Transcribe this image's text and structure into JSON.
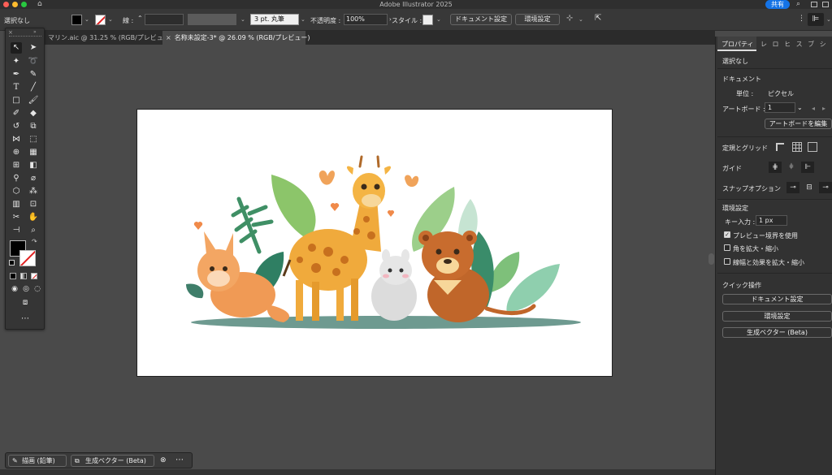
{
  "window": {
    "title": "Adobe Illustrator 2025",
    "share_label": "共有"
  },
  "controlbar": {
    "selection": "選択なし",
    "stroke_label": "線 :",
    "brush_label": "3 pt. 丸筆",
    "opacity_label": "不透明度 :",
    "opacity_value": "100%",
    "style_label": "スタイル :",
    "document_settings": "ドキュメント設定",
    "preferences": "環境設定"
  },
  "tabs": [
    {
      "label": "マリン.aic @ 31.25 % (RGB/プレビュー)"
    },
    {
      "label": "名称未設定-3* @ 26.09 % (RGB/プレビュー)"
    }
  ],
  "properties": {
    "tab_active": "プロパティ",
    "tab_others": "レ ロ ヒ ス ブ シ ア",
    "selection": "選択なし",
    "doc_section": "ドキュメント",
    "unit_label": "単位 :",
    "unit_value": "ピクセル",
    "artboard_label": "アートボード :",
    "artboard_value": "1",
    "edit_artboard": "アートボードを編集",
    "rulers_grids": "定規とグリッド",
    "guides": "ガイド",
    "snap_options": "スナップオプション",
    "prefs_section": "環境設定",
    "key_increment_label": "キー入力 :",
    "key_increment_value": "1 px",
    "preview_bounds": "プレビュー境界を使用",
    "scale_corners": "角を拡大・縮小",
    "scale_strokes": "線幅と効果を拡大・縮小",
    "quick_actions": "クイック操作",
    "qa_document_settings": "ドキュメント設定",
    "qa_preferences": "環境設定",
    "qa_generative_vector": "生成ベクター (Beta)"
  },
  "bottom": {
    "draw_mode": "描画 (鉛筆)",
    "generative_vector": "生成ベクター (Beta)"
  },
  "colors": {
    "accent": "#1473e6",
    "ui_bg": "#4a4a4a",
    "panel_bg": "#323232"
  }
}
